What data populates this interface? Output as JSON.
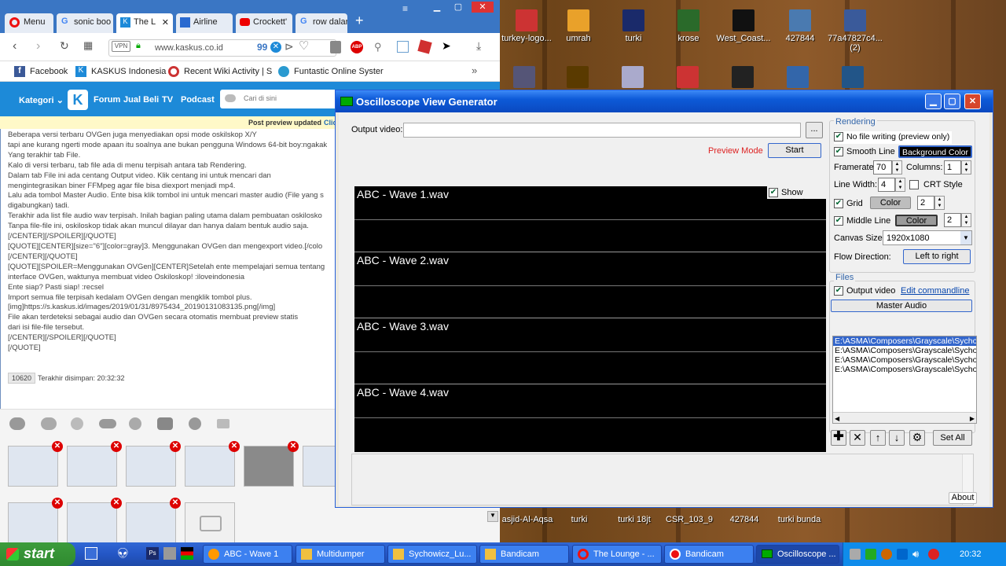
{
  "desktop": {
    "icons": [
      {
        "label": "turkey-logo..."
      },
      {
        "label": "umrah"
      },
      {
        "label": "turki"
      },
      {
        "label": "krose"
      },
      {
        "label": "West_Coast..."
      },
      {
        "label": "427844"
      },
      {
        "label": "77a47827c4...\n(2)"
      }
    ],
    "bottom_icons": [
      {
        "label": "asjid-Al-Aqsa"
      },
      {
        "label": "turki"
      },
      {
        "label": "turki 18jt"
      },
      {
        "label": "CSR_103_9"
      },
      {
        "label": "427844"
      },
      {
        "label": "turki bunda"
      }
    ]
  },
  "browser": {
    "tabs": [
      {
        "label": "Menu"
      },
      {
        "label": "sonic boo"
      },
      {
        "label": "The L"
      },
      {
        "label": "Airline"
      },
      {
        "label": "Crockett'"
      },
      {
        "label": "row dalar"
      }
    ],
    "vpn_label": "VPN",
    "url": "www.kaskus.co.id",
    "badge_count": "99",
    "bookmarks": [
      {
        "label": "Facebook"
      },
      {
        "label": "KASKUS Indonesia"
      },
      {
        "label": "Recent Wiki Activity | S"
      },
      {
        "label": "Funtastic Online Syster"
      }
    ],
    "nav": {
      "kategori": "Kategori",
      "forum": "Forum",
      "jual_beli": "Jual Beli",
      "tv": "TV",
      "podcast": "Podcast",
      "search_placeholder": "Cari di sini"
    },
    "post_preview": "Post preview updated",
    "post_preview_link": "Clic",
    "editor_lines": [
      "Beberapa versi terbaru OVGen juga menyediakan opsi mode oskilskop X/Y",
      "tapi ane kurang ngerti mode apaan itu soalnya ane bukan pengguna Windows 64-bit boy:ngakak",
      "Yang terakhir tab File.",
      "Kalo di versi terbaru, tab file ada di menu terpisah antara tab Rendering.",
      "Dalam tab File ini ada centang Output video. Klik centang ini untuk mencari dan",
      "mengintegrasikan biner FFMpeg agar file bisa diexport menjadi mp4.",
      "Lalu ada tombol Master Audio. Ente bisa klik tombol ini untuk mencari master audio (File yang s",
      "digabungkan) tadi.",
      "Terakhir ada list file audio wav terpisah. Inilah bagian paling utama dalam pembuatan oskilosko",
      "Tanpa file-file ini, oskiloskop tidak akan muncul dilayar dan hanya dalam bentuk audio saja.",
      "[/CENTER][/SPOILER][/QUOTE]",
      "[QUOTE][CENTER][size=\"6\"][color=gray]3. Menggunakan OVGen dan mengexport video.[/colo",
      "[/CENTER][/QUOTE]",
      "[QUOTE][SPOILER=Menggunakan OVGen][CENTER]Setelah ente mempelajari semua tentang",
      "interface OVGen, waktunya membuat video Oskiloskop! :iloveindonesia",
      "Ente siap? Pasti siap! :recsel",
      "Import semua file terpisah kedalam OVGen dengan mengklik tombol plus.",
      "[img]https://s.kaskus.id/images/2019/01/31/8975434_20190131083135.png[/img]",
      "File akan terdeteksi sebagai audio dan OVGen secara otomatis membuat preview statis",
      "dari isi file-file tersebut.",
      "",
      "[/CENTER][/SPOILER][/QUOTE]",
      "[/QUOTE]"
    ],
    "char_count": "10620",
    "saved_text": "Terakhir disimpan: 20:32:32"
  },
  "osc": {
    "title": "Oscilloscope View Generator",
    "output_video_label": "Output video:",
    "output_video_value": "",
    "browse_label": "...",
    "preview_mode": "Preview Mode",
    "start_label": "Start",
    "show_output": "Show output",
    "waves": [
      {
        "name": "ABC - Wave 1.wav"
      },
      {
        "name": "ABC - Wave 2.wav"
      },
      {
        "name": "ABC - Wave 3.wav"
      },
      {
        "name": "ABC - Wave 4.wav"
      }
    ],
    "rendering": {
      "legend": "Rendering",
      "no_file_writing": "No file writing (preview only)",
      "smooth_line": "Smooth Line",
      "background_color": "Background Color",
      "framerate_label": "Framerate:",
      "framerate": "70",
      "columns_label": "Columns:",
      "columns": "1",
      "line_width_label": "Line Width:",
      "line_width": "4",
      "crt_style": "CRT  Style",
      "grid": "Grid",
      "grid_color": "Color",
      "grid_value": "2",
      "middle_line": "Middle Line",
      "middle_color": "Color",
      "middle_value": "2",
      "canvas_size_label": "Canvas Size:",
      "canvas_size": "1920x1080",
      "flow_direction_label": "Flow Direction:",
      "flow_direction": "Left to right"
    },
    "files": {
      "legend": "Files",
      "output_video": "Output video",
      "edit_commandline": "Edit commandline",
      "master_audio": "Master Audio",
      "list": [
        "E:\\ASMA\\Composers\\Grayscale\\Sycho",
        "E:\\ASMA\\Composers\\Grayscale\\Sycho",
        "E:\\ASMA\\Composers\\Grayscale\\Sycho",
        "E:\\ASMA\\Composers\\Grayscale\\Sycho"
      ],
      "set_all": "Set All"
    },
    "about": "About"
  },
  "taskbar": {
    "start": "start",
    "tasks": [
      {
        "label": "ABC - Wave 1"
      },
      {
        "label": "Multidumper"
      },
      {
        "label": "Sychowicz_Lu..."
      },
      {
        "label": "Bandicam"
      },
      {
        "label": "The Lounge - ..."
      },
      {
        "label": "Bandicam"
      },
      {
        "label": "Oscilloscope ..."
      }
    ],
    "clock": "20:32"
  }
}
